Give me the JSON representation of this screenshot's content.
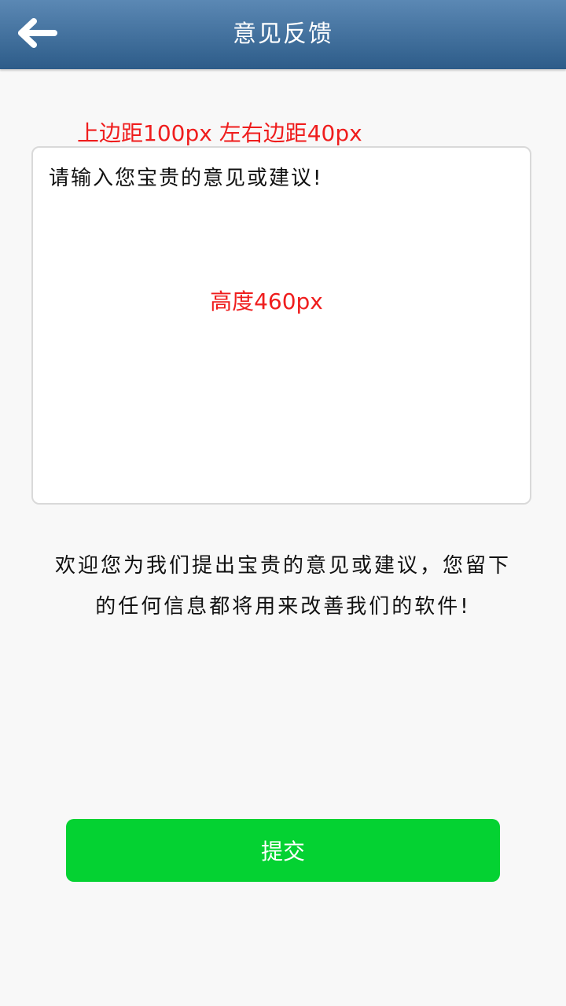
{
  "header": {
    "title": "意见反馈",
    "back_icon": "back-arrow-icon",
    "background_color": "#3b6c98"
  },
  "annotations": {
    "top_margin": "上边距100px 左右边距40px",
    "box_height": "高度460px",
    "color": "#ef1d1d"
  },
  "feedback": {
    "placeholder": "请输入您宝贵的意见或建议!"
  },
  "message": {
    "line1": "欢迎您为我们提出宝贵的意见或建议，您留下",
    "line2": "的任何信息都将用来改善我们的软件!"
  },
  "submit": {
    "label": "提交",
    "color": "#04d232"
  }
}
